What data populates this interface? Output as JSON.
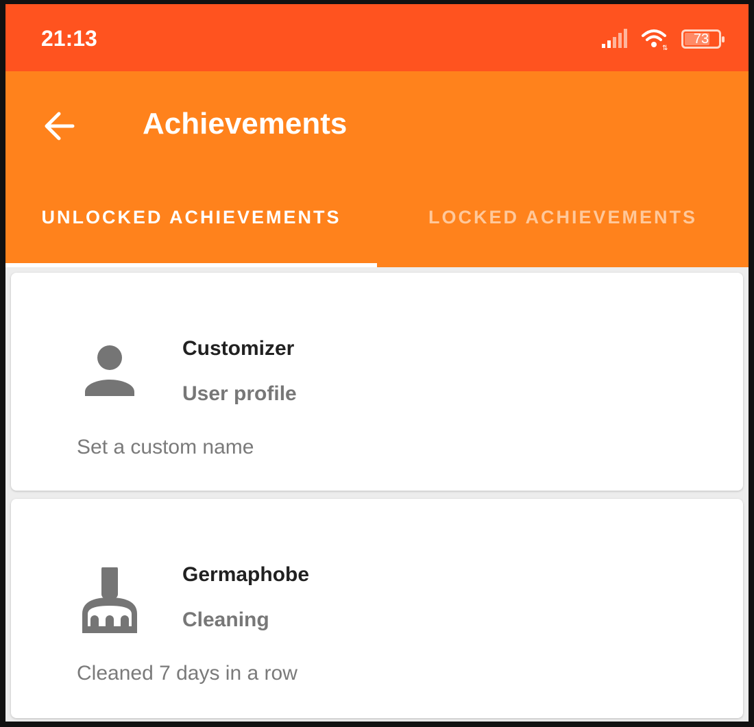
{
  "status_bar": {
    "time": "21:13",
    "battery": "73",
    "icons": [
      "signal-icon",
      "wifi-icon",
      "battery-icon"
    ]
  },
  "app_bar": {
    "title": "Achievements",
    "back_icon": "arrow-back-icon"
  },
  "tabs": [
    {
      "label": "UNLOCKED ACHIEVEMENTS",
      "selected": true
    },
    {
      "label": "LOCKED ACHIEVEMENTS",
      "selected": false
    }
  ],
  "achievements": [
    {
      "name": "Customizer",
      "category": "User profile",
      "description": "Set a custom name",
      "icon": "person-icon"
    },
    {
      "name": "Germaphobe",
      "category": "Cleaning",
      "description": "Cleaned 7 days in a row",
      "icon": "broom-icon"
    }
  ],
  "colors": {
    "status": "#FF531F",
    "appbar": "#FF821C",
    "icon": "#757575"
  }
}
